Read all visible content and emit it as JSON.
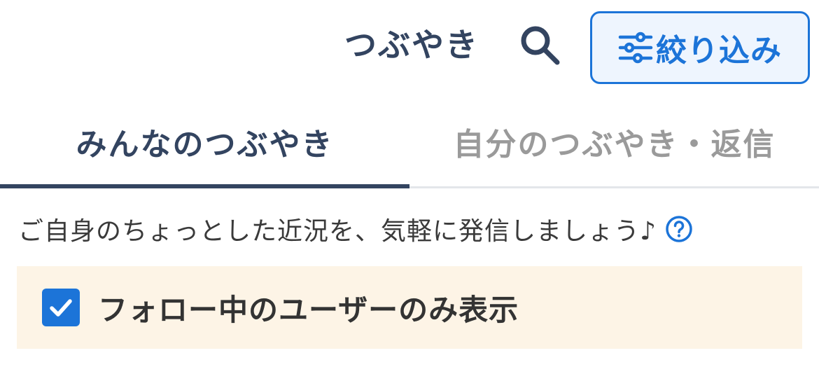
{
  "header": {
    "title": "つぶやき",
    "search_icon": "search-icon",
    "filter_button_label": "絞り込み",
    "filter_icon": "sliders-icon"
  },
  "tabs": [
    {
      "label": "みんなのつぶやき",
      "active": true
    },
    {
      "label": "自分のつぶやき・返信",
      "active": false
    }
  ],
  "intro": {
    "text": "ご自身のちょっとした近況を、気軽に発信しましょう♪",
    "help_icon": "question-circle-icon"
  },
  "follow_filter": {
    "label": "フォロー中のユーザーのみ表示",
    "checked": true
  },
  "colors": {
    "accent": "#1c74d8",
    "heading": "#334460",
    "inactive_tab": "#9a9a9a",
    "notice_bg": "#fdf4e6",
    "filter_bg": "#eef5fe"
  }
}
